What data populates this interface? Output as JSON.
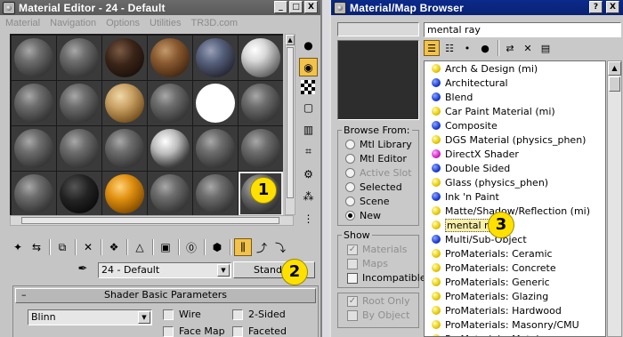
{
  "material_editor": {
    "title": "Material Editor - 24 - Default",
    "menu": [
      "Material",
      "Navigation",
      "Options",
      "Utilities",
      "TR3D.com"
    ],
    "title_buttons": [
      "_",
      "□",
      "X"
    ],
    "material_name": "24 - Default",
    "type_button": "Standard",
    "rollout_title": "Shader Basic Parameters",
    "rollout_toggle": "–",
    "shader": "Blinn",
    "options": {
      "wire": "Wire",
      "two_sided": "2-Sided",
      "face_map": "Face Map",
      "faceted": "Faceted"
    }
  },
  "browser": {
    "title": "Material/Map Browser",
    "title_buttons": [
      "?",
      "X"
    ],
    "search_value": "",
    "name_field": "mental ray",
    "browse_from": {
      "label": "Browse From:",
      "options": [
        "Mtl Library",
        "Mtl Editor",
        "Active Slot",
        "Selected",
        "Scene",
        "New"
      ],
      "selected": "New"
    },
    "show": {
      "label": "Show",
      "materials": "Materials",
      "maps": "Maps",
      "incompatible": "Incompatible",
      "root_only": "Root Only",
      "by_object": "By Object"
    },
    "items": [
      {
        "name": "Arch & Design (mi)",
        "color": "y"
      },
      {
        "name": "Architectural",
        "color": "b"
      },
      {
        "name": "Blend",
        "color": "b"
      },
      {
        "name": "Car Paint Material (mi)",
        "color": "y"
      },
      {
        "name": "Composite",
        "color": "b"
      },
      {
        "name": "DGS Material (physics_phen)",
        "color": "y"
      },
      {
        "name": "DirectX Shader",
        "color": "m"
      },
      {
        "name": "Double Sided",
        "color": "b"
      },
      {
        "name": "Glass (physics_phen)",
        "color": "y"
      },
      {
        "name": "Ink 'n Paint",
        "color": "b"
      },
      {
        "name": "Matte/Shadow/Reflection (mi)",
        "color": "y"
      },
      {
        "name": "mental ray",
        "color": "y"
      },
      {
        "name": "Multi/Sub-Object",
        "color": "b"
      },
      {
        "name": "ProMaterials: Ceramic",
        "color": "y"
      },
      {
        "name": "ProMaterials: Concrete",
        "color": "y"
      },
      {
        "name": "ProMaterials: Generic",
        "color": "y"
      },
      {
        "name": "ProMaterials: Glazing",
        "color": "y"
      },
      {
        "name": "ProMaterials: Hardwood",
        "color": "y"
      },
      {
        "name": "ProMaterials: Masonry/CMU",
        "color": "y"
      },
      {
        "name": "ProMaterials: Metal",
        "color": "y"
      }
    ]
  },
  "callouts": [
    "1",
    "2",
    "3"
  ],
  "colors": {
    "browser_title_bg": "#0b2a8a",
    "editor_title_bg": "#5f5f5f",
    "active_tool": "#f2c24a",
    "callout": "#ffe000"
  }
}
